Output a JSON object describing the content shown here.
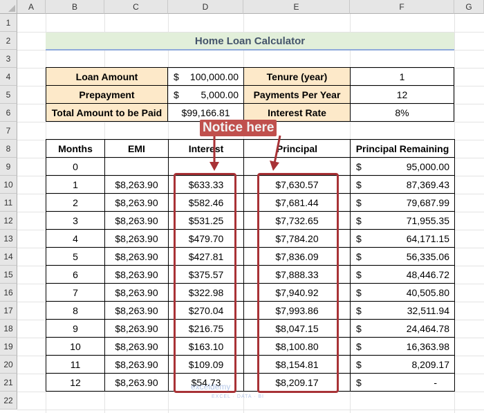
{
  "columns": [
    "A",
    "B",
    "C",
    "D",
    "E",
    "F",
    "G"
  ],
  "rows": [
    "1",
    "2",
    "3",
    "4",
    "5",
    "6",
    "7",
    "8",
    "9",
    "10",
    "11",
    "12",
    "13",
    "14",
    "15",
    "16",
    "17",
    "18",
    "19",
    "20",
    "21",
    "22"
  ],
  "title": "Home Loan Calculator",
  "inputs": {
    "loan_amount_label": "Loan Amount",
    "loan_amount_sym": "$",
    "loan_amount_value": "100,000.00",
    "prepayment_label": "Prepayment",
    "prepayment_sym": "$",
    "prepayment_value": "5,000.00",
    "total_label": "Total Amount to be Paid",
    "total_value": "$99,166.81",
    "tenure_label": "Tenure (year)",
    "tenure_value": "1",
    "payments_label": "Payments Per Year",
    "payments_value": "12",
    "rate_label": "Interest Rate",
    "rate_value": "8%"
  },
  "table": {
    "headers": [
      "Months",
      "EMI",
      "Interest",
      "Principal",
      "Principal Remaining"
    ],
    "rows": [
      {
        "month": "0",
        "emi": "",
        "interest": "",
        "principal": "",
        "sym": "$",
        "remaining": "95,000.00"
      },
      {
        "month": "1",
        "emi": "$8,263.90",
        "interest": "$633.33",
        "principal": "$7,630.57",
        "sym": "$",
        "remaining": "87,369.43"
      },
      {
        "month": "2",
        "emi": "$8,263.90",
        "interest": "$582.46",
        "principal": "$7,681.44",
        "sym": "$",
        "remaining": "79,687.99"
      },
      {
        "month": "3",
        "emi": "$8,263.90",
        "interest": "$531.25",
        "principal": "$7,732.65",
        "sym": "$",
        "remaining": "71,955.35"
      },
      {
        "month": "4",
        "emi": "$8,263.90",
        "interest": "$479.70",
        "principal": "$7,784.20",
        "sym": "$",
        "remaining": "64,171.15"
      },
      {
        "month": "5",
        "emi": "$8,263.90",
        "interest": "$427.81",
        "principal": "$7,836.09",
        "sym": "$",
        "remaining": "56,335.06"
      },
      {
        "month": "6",
        "emi": "$8,263.90",
        "interest": "$375.57",
        "principal": "$7,888.33",
        "sym": "$",
        "remaining": "48,446.72"
      },
      {
        "month": "7",
        "emi": "$8,263.90",
        "interest": "$322.98",
        "principal": "$7,940.92",
        "sym": "$",
        "remaining": "40,505.80"
      },
      {
        "month": "8",
        "emi": "$8,263.90",
        "interest": "$270.04",
        "principal": "$7,993.86",
        "sym": "$",
        "remaining": "32,511.94"
      },
      {
        "month": "9",
        "emi": "$8,263.90",
        "interest": "$216.75",
        "principal": "$8,047.15",
        "sym": "$",
        "remaining": "24,464.78"
      },
      {
        "month": "10",
        "emi": "$8,263.90",
        "interest": "$163.10",
        "principal": "$8,100.80",
        "sym": "$",
        "remaining": "16,363.98"
      },
      {
        "month": "11",
        "emi": "$8,263.90",
        "interest": "$109.09",
        "principal": "$8,154.81",
        "sym": "$",
        "remaining": "8,209.17"
      },
      {
        "month": "12",
        "emi": "$8,263.90",
        "interest": "$54.73",
        "principal": "$8,209.17",
        "sym": "$",
        "remaining": "-"
      }
    ]
  },
  "annotation": {
    "text": "Notice here",
    "color": "#c0504d",
    "box_color": "#a83236"
  },
  "watermark": {
    "name": "exceldemy",
    "tagline": "EXCEL · DATA · BI"
  },
  "colors": {
    "label_fill": "#fde9c9",
    "title_fill": "#e2efda",
    "title_text": "#44546a"
  }
}
